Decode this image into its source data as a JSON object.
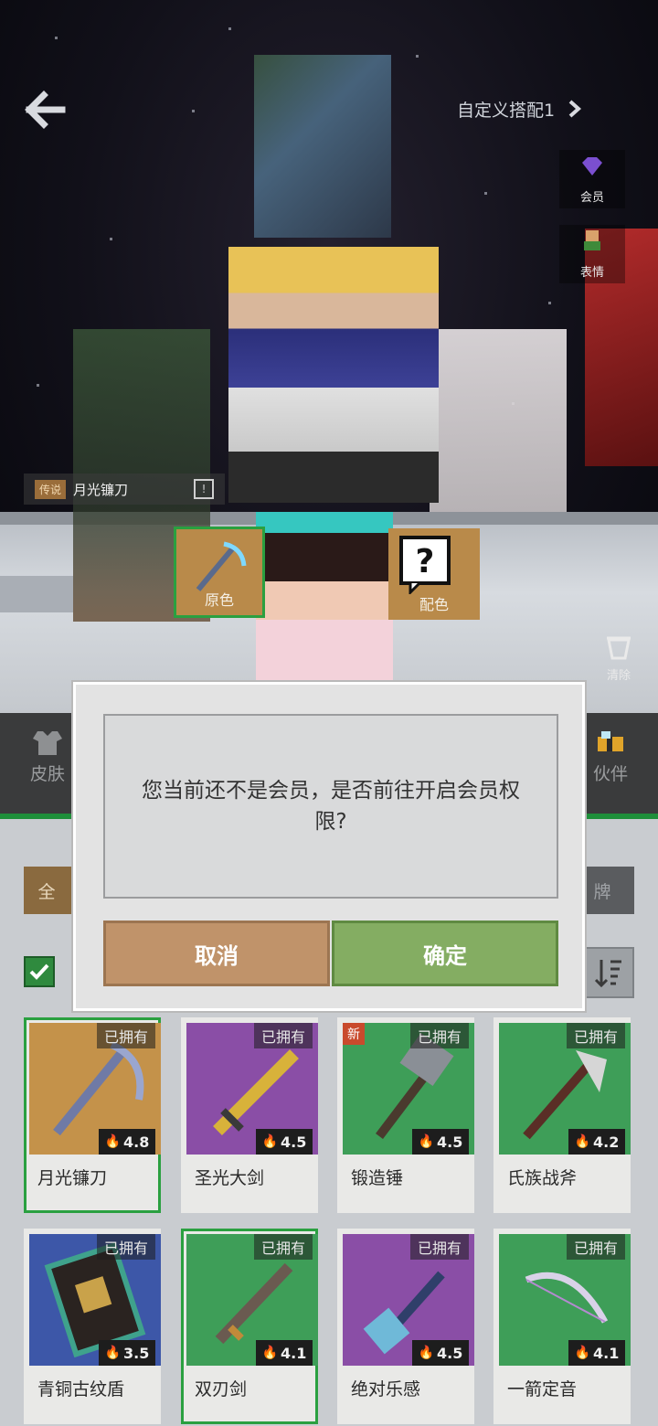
{
  "header": {
    "outfit_name": "自定义搭配1"
  },
  "side_buttons": {
    "vip_label": "会员",
    "emote_label": "表情"
  },
  "equipped_weapon": {
    "tier": "传说",
    "name": "月光镰刀"
  },
  "color_options": {
    "original": "原色",
    "match": "配色"
  },
  "clear_label": "清除",
  "categories": [
    {
      "label": "皮肤"
    },
    {
      "label": "伙伴"
    }
  ],
  "filter_tabs": {
    "all_partial": "全",
    "badge_partial": "牌"
  },
  "items": [
    {
      "name": "月光镰刀",
      "status": "已拥有",
      "rating": "4.8",
      "is_new": "",
      "bg": "#c4924a"
    },
    {
      "name": "圣光大剑",
      "status": "已拥有",
      "rating": "4.5",
      "is_new": "",
      "bg": "#8a4ea6"
    },
    {
      "name": "锻造锤",
      "status": "已拥有",
      "rating": "4.5",
      "is_new": "新",
      "bg": "#3e9e58"
    },
    {
      "name": "氏族战斧",
      "status": "已拥有",
      "rating": "4.2",
      "is_new": "",
      "bg": "#3e9e58"
    },
    {
      "name": "青铜古纹盾",
      "status": "已拥有",
      "rating": "3.5",
      "is_new": "",
      "bg": "#3d57a8"
    },
    {
      "name": "双刃剑",
      "status": "已拥有",
      "rating": "4.1",
      "is_new": "",
      "bg": "#3e9e58"
    },
    {
      "name": "绝对乐感",
      "status": "已拥有",
      "rating": "4.5",
      "is_new": "",
      "bg": "#8a4ea6"
    },
    {
      "name": "一箭定音",
      "status": "已拥有",
      "rating": "4.1",
      "is_new": "",
      "bg": "#3e9e58"
    }
  ],
  "dialog": {
    "message": "您当前还不是会员，是否前往开启会员权限?",
    "cancel_label": "取消",
    "confirm_label": "确定"
  },
  "colors": {
    "accent_green": "#2aa040",
    "cancel": "#c0936a",
    "confirm": "#84ad62"
  }
}
